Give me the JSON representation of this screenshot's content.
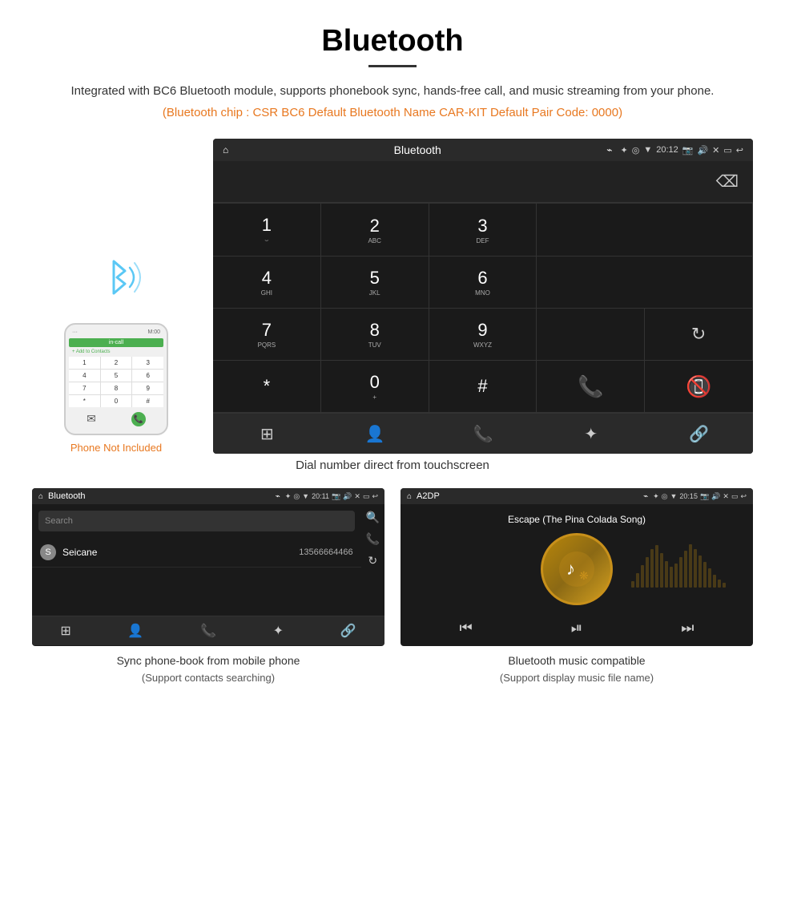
{
  "page": {
    "title": "Bluetooth",
    "subtitle": "Integrated with BC6 Bluetooth module, supports phonebook sync, hands-free call, and music streaming from your phone.",
    "specs": "(Bluetooth chip : CSR BC6    Default Bluetooth Name CAR-KIT    Default Pair Code: 0000)",
    "dial_caption": "Dial number direct from touchscreen",
    "phone_not_included": "Phone Not Included",
    "bottom_left_caption_line1": "Sync phone-book from mobile phone",
    "bottom_left_caption_line2": "(Support contacts searching)",
    "bottom_right_caption_line1": "Bluetooth music compatible",
    "bottom_right_caption_line2": "(Support display music file name)"
  },
  "dial_screen": {
    "title": "Bluetooth",
    "time": "20:12",
    "keypad": [
      {
        "number": "1",
        "letters": "⌣"
      },
      {
        "number": "2",
        "letters": "ABC"
      },
      {
        "number": "3",
        "letters": "DEF"
      },
      {
        "number": "4",
        "letters": "GHI"
      },
      {
        "number": "5",
        "letters": "JKL"
      },
      {
        "number": "6",
        "letters": "MNO"
      },
      {
        "number": "7",
        "letters": "PQRS"
      },
      {
        "number": "8",
        "letters": "TUV"
      },
      {
        "number": "9",
        "letters": "WXYZ"
      },
      {
        "number": "*",
        "letters": ""
      },
      {
        "number": "0",
        "letters": "+"
      },
      {
        "number": "#",
        "letters": ""
      }
    ]
  },
  "phonebook_screen": {
    "title": "Bluetooth",
    "time": "20:11",
    "search_placeholder": "Search",
    "contact_letter": "S",
    "contact_name": "Seicane",
    "contact_number": "13566664466"
  },
  "music_screen": {
    "title": "A2DP",
    "time": "20:15",
    "song_title": "Escape (The Pina Colada Song)"
  },
  "phone_keypad_keys": [
    "1",
    "2",
    "3",
    "4",
    "5",
    "6",
    "7",
    "8",
    "9",
    "*",
    "0",
    "#"
  ],
  "icons": {
    "home": "⌂",
    "back": "↩",
    "bluetooth": "❋",
    "location": "◎",
    "wifi": "▼",
    "battery": "▮",
    "volume": "🔊",
    "camera": "📷",
    "close_x": "✕",
    "window": "▭",
    "usb": "⌁",
    "call_green": "📞",
    "call_red": "📵",
    "refresh": "↻",
    "grid": "⊞",
    "person": "👤",
    "phone": "📞",
    "link": "🔗",
    "search": "🔍",
    "prev": "⏮",
    "play_pause": "⏯",
    "next": "⏭"
  }
}
